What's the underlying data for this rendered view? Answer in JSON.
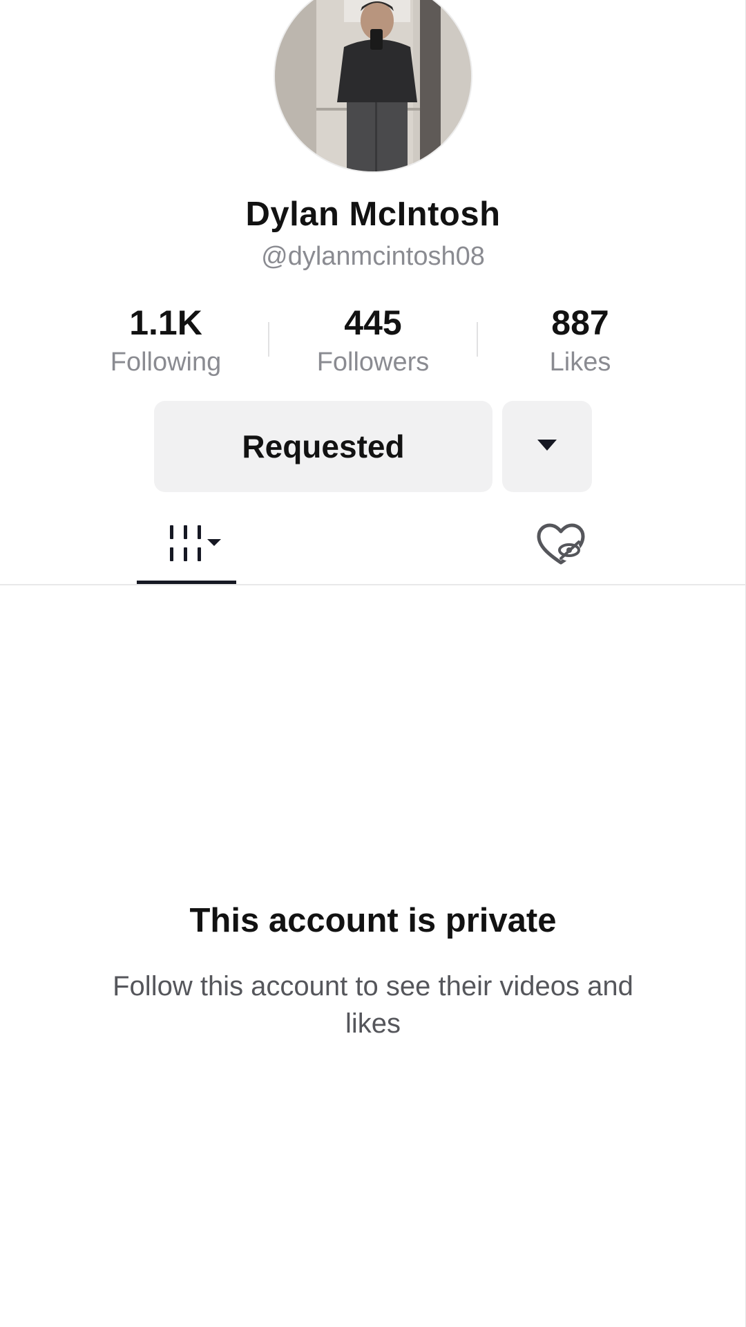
{
  "profile": {
    "display_name": "Dylan McIntosh",
    "username": "@dylanmcintosh08"
  },
  "stats": [
    {
      "value": "1.1K",
      "label": "Following"
    },
    {
      "value": "445",
      "label": "Followers"
    },
    {
      "value": "887",
      "label": "Likes"
    }
  ],
  "actions": {
    "requested_label": "Requested",
    "dropdown_icon": "caret-down-icon"
  },
  "tabs": {
    "videos_icon": "videos-grid-icon",
    "liked_icon": "liked-hidden-icon",
    "active": "videos"
  },
  "private_notice": {
    "title": "This account is private",
    "message": "Follow this account to see their videos and likes"
  },
  "colors": {
    "text_primary": "#121212",
    "text_secondary": "#8a8b91",
    "button_bg": "#f1f1f2",
    "divider": "#e8e8e9"
  }
}
